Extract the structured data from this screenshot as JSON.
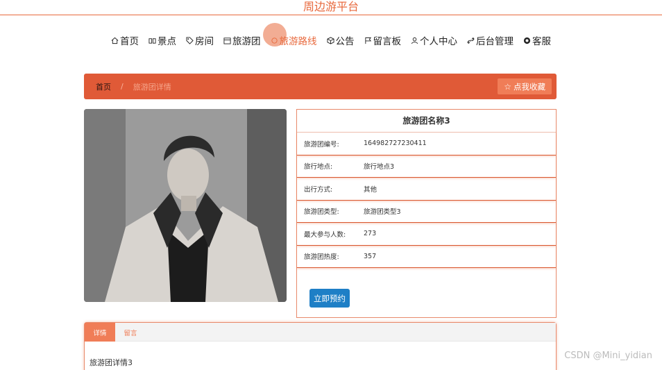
{
  "site": {
    "title": "周边游平台"
  },
  "nav": {
    "items": [
      {
        "label": "首页",
        "icon": "home-icon"
      },
      {
        "label": "景点",
        "icon": "binoculars-icon"
      },
      {
        "label": "房间",
        "icon": "tag-icon"
      },
      {
        "label": "旅游团",
        "icon": "calendar-icon"
      },
      {
        "label": "旅游路线",
        "icon": "route-icon"
      },
      {
        "label": "公告",
        "icon": "cube-icon"
      },
      {
        "label": "留言板",
        "icon": "flag-icon"
      },
      {
        "label": "个人中心",
        "icon": "user-icon"
      },
      {
        "label": "后台管理",
        "icon": "link-icon"
      },
      {
        "label": "客服",
        "icon": "headset-icon"
      }
    ],
    "active_index": 4
  },
  "breadcrumb": {
    "home": "首页",
    "separator": "/",
    "current": "旅游团详情"
  },
  "favorite_button": {
    "label": "点我收藏",
    "icon": "star-icon"
  },
  "detail": {
    "title": "旅游团名称3",
    "rows": [
      {
        "key": "旅游团编号:",
        "value": "164982727230411"
      },
      {
        "key": "旅行地点:",
        "value": "旅行地点3"
      },
      {
        "key": "出行方式:",
        "value": "其他"
      },
      {
        "key": "旅游团类型:",
        "value": "旅游团类型3"
      },
      {
        "key": "最大参与人数:",
        "value": "273"
      },
      {
        "key": "旅游团热度:",
        "value": "357"
      }
    ],
    "book_button": "立即预约"
  },
  "tabs": {
    "items": [
      "详情",
      "留言"
    ],
    "active_index": 0,
    "content": "旅游团详情3"
  },
  "watermark": "CSDN @Mini_yidian",
  "colors": {
    "accent": "#e8693d",
    "primary_button": "#1e7fc6"
  }
}
